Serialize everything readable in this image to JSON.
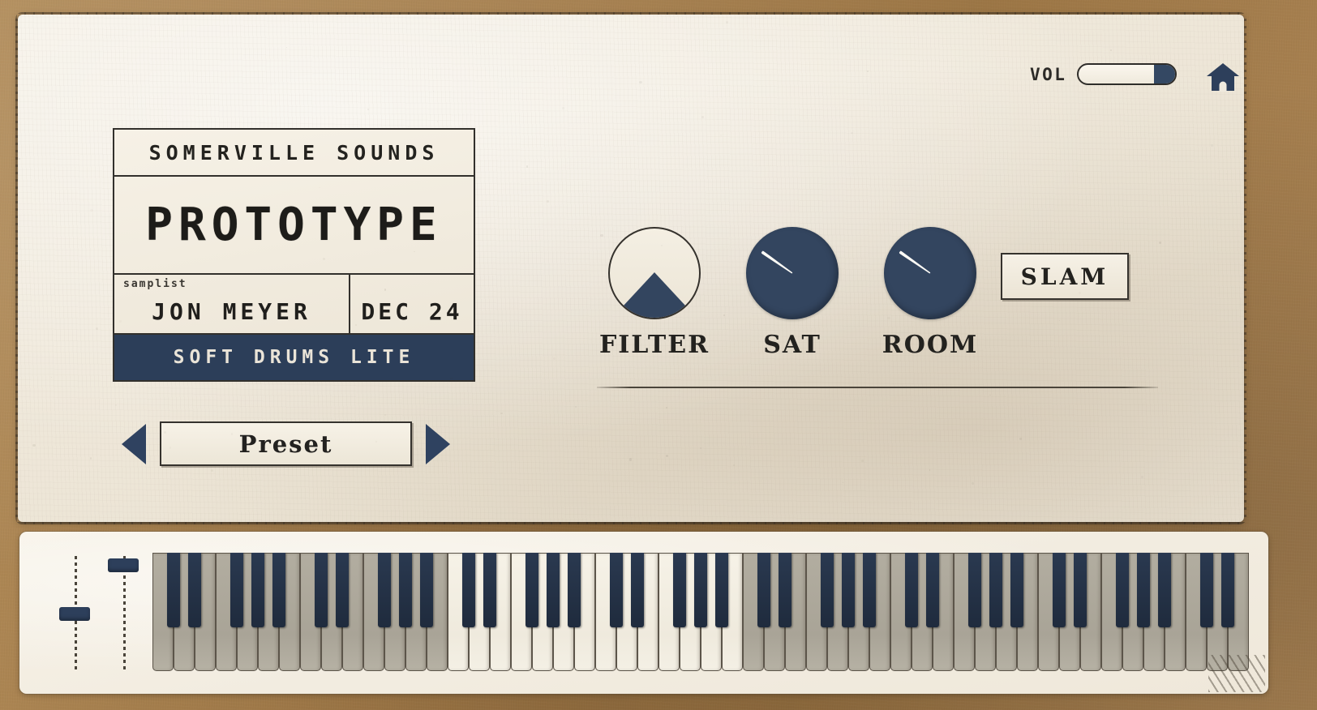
{
  "app": {
    "background_color": "#a98250",
    "panel_color": "#f2ece0",
    "accent_navy": "#33455f",
    "ink_color": "#23221f"
  },
  "header": {
    "vol_label": "VOL",
    "vol_value_pct": 82,
    "home_icon": "home-icon"
  },
  "label_card": {
    "brand": "SOMERVILLE SOUNDS",
    "title": "PROTOTYPE",
    "artist_tag": "samplist",
    "artist": "JON MEYER",
    "date": "DEC 24",
    "banner": "SOFT DRUMS LITE"
  },
  "preset": {
    "prev_icon": "triangle-left-icon",
    "label": "Preset",
    "next_icon": "triangle-right-icon"
  },
  "knobs": [
    {
      "label": "FILTER",
      "style": "outline",
      "icon": "mountain-shape",
      "angle_deg": 0,
      "value_pct": 50
    },
    {
      "label": "SAT",
      "style": "solid",
      "icon": "knob-indicator",
      "angle_deg": 215,
      "value_pct": 12
    },
    {
      "label": "ROOM",
      "style": "solid",
      "icon": "knob-indicator",
      "angle_deg": 215,
      "value_pct": 12
    }
  ],
  "slam": {
    "label": "SLAM"
  },
  "keyboard": {
    "wheel1": {
      "name": "pitch-wheel",
      "position_pct": 50
    },
    "wheel2": {
      "name": "mod-wheel",
      "position_pct": 5
    },
    "total_white_keys": 52,
    "active_octave_groups": [
      0,
      1,
      2,
      3,
      4,
      5
    ],
    "grey_octave_groups": [
      0,
      1,
      4,
      5,
      6,
      7
    ]
  }
}
